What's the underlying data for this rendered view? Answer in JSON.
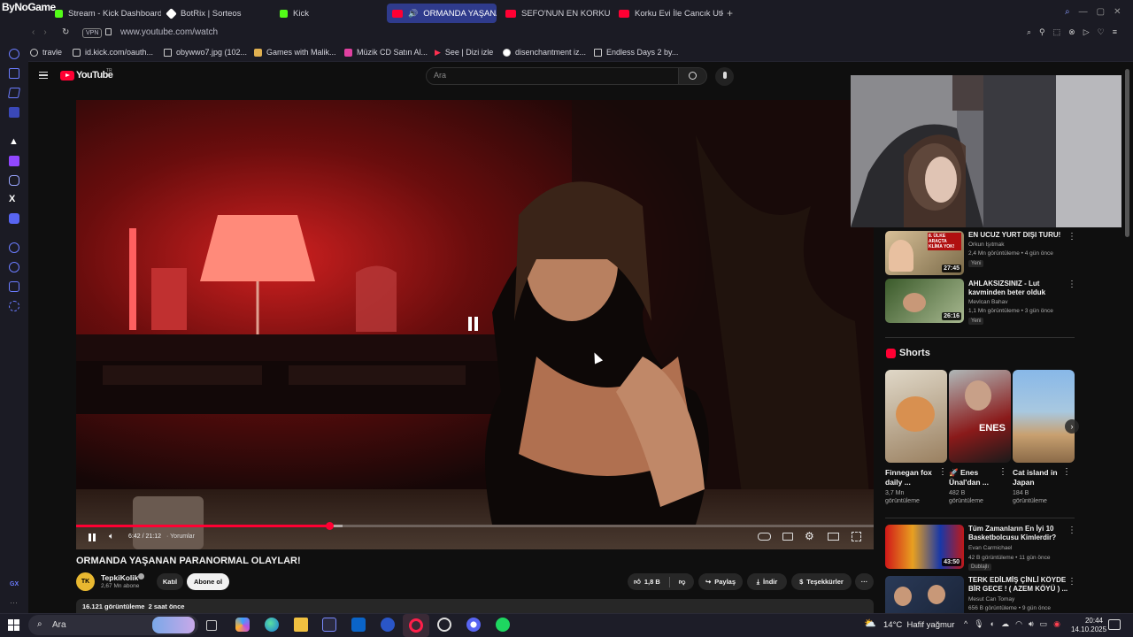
{
  "browser": {
    "brand": "ByNoGame",
    "tabs": [
      {
        "label": "Stream - Kick Dashboard",
        "color": "#53fc18"
      },
      {
        "label": "BotRix | Sorteos",
        "color": "#ffffff"
      },
      {
        "label": "Kick",
        "color": "#53fc18"
      },
      {
        "label": "ORMANDA YAŞANAN",
        "color": "#ff0033",
        "active": true
      },
      {
        "label": "SEFO'NUN EN KORKULU",
        "color": "#ff0033"
      },
      {
        "label": "Korku Evi İle Cancık Utku",
        "color": "#ff0033"
      }
    ],
    "vpn_label": "VPN",
    "url": "www.youtube.com/watch",
    "bookmarks": [
      "travle",
      "id.kick.com/oauth...",
      "obywwo7.jpg (102...",
      "Games with Malik...",
      "Müzik CD Satın Al...",
      "See | Dizi izle",
      "disenchantment iz...",
      "Endless Days 2 by..."
    ],
    "rail_bottom_label": "GX"
  },
  "youtube": {
    "logo": "YouTube",
    "logo_region": "TR",
    "search_placeholder": "Ara",
    "player": {
      "time": "6:42 / 21:12",
      "chapter": "· Yorumlar",
      "progress_fraction": 0.317,
      "buffer_fraction": 0.334
    },
    "video_title": "ORMANDA YAŞANAN PARANORMAL OLAYLAR!",
    "channel": {
      "name": "TepkiKolik",
      "subs": "2,67 Mn abone",
      "avatar_text": "TK"
    },
    "buttons": {
      "join": "Katıl",
      "subscribe": "Abone ol",
      "likes": "1,8 B",
      "share": "Paylaş",
      "download": "İndir",
      "thanks": "Teşekkürler"
    },
    "meta": "16.121 görüntüleme  2 saat önce",
    "related_top": [
      {
        "title": "EN UCUZ YURT DIŞI TURU!",
        "channel": "Orkun Işıtmak",
        "meta": "2,4 Mn görüntüleme • 4 gün önce",
        "badge": "Yeni",
        "duration": "27:45",
        "thumb_text": "8. ÜLKE ARAÇTA KLİMA YOK!"
      },
      {
        "title": "AHLAKSIZSINIZ - Lut kavminden beter olduk",
        "channel": "Mevlcan Bahav",
        "meta": "1,1 Mn görüntüleme • 3 gün önce",
        "badge": "Yeni",
        "duration": "26:16"
      }
    ],
    "shorts_heading": "Shorts",
    "shorts": [
      {
        "title": "Finnegan fox daily ...",
        "views": "3,7 Mn görüntüleme"
      },
      {
        "title": "🚀 Enes Ünal'dan ...",
        "views": "482 B görüntüleme",
        "thumb_text": "ENES"
      },
      {
        "title": "Cat island in Japan",
        "views": "184 B görüntüleme"
      }
    ],
    "related_bottom": [
      {
        "title": "Tüm Zamanların En İyi 10 Basketbolcusu Kimlerdir?",
        "channel": "Evan Carmichael",
        "meta": "42 B görüntüleme • 11 gün önce",
        "badge": "Dublajlı",
        "duration": "43:50"
      },
      {
        "title": "TERK EDİLMİŞ ÇİNLİ KÖYDE BİR GECE ! ( AZEM KÖYÜ ) ...",
        "channel": "Mesut Can Tomay",
        "meta": "656 B görüntüleme • 9 gün önce"
      }
    ]
  },
  "taskbar": {
    "search": "Ara",
    "weather": "14°C  Hafif yağmur",
    "time": "20:44",
    "date": "14.10.2025"
  }
}
